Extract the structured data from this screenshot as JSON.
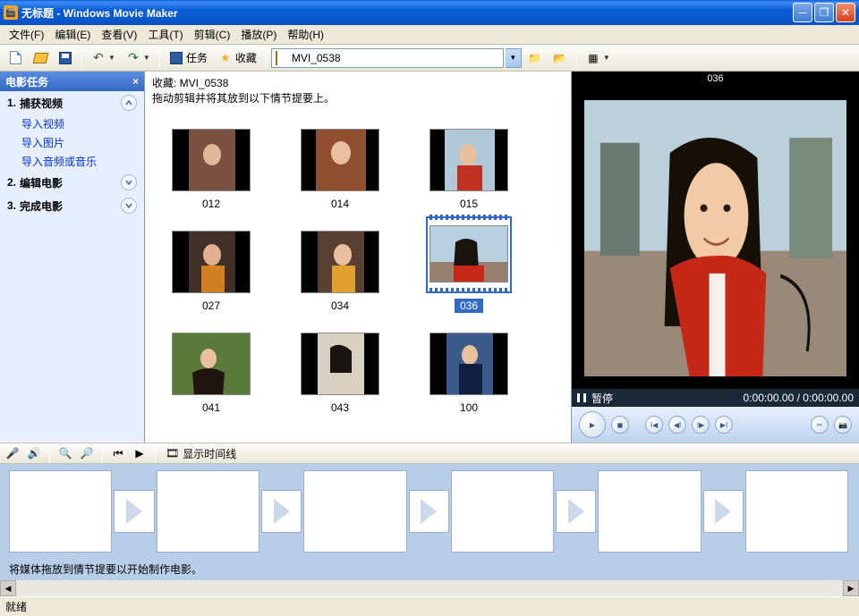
{
  "window": {
    "title": "无标题 - Windows Movie Maker"
  },
  "menu": {
    "file": "文件(F)",
    "edit": "编辑(E)",
    "view": "查看(V)",
    "tools": "工具(T)",
    "clip": "剪辑(C)",
    "play": "播放(P)",
    "help": "帮助(H)"
  },
  "toolbar": {
    "tasks": "任务",
    "collection": "收藏",
    "selected_collection": "MVI_0538"
  },
  "tasks": {
    "header": "电影任务",
    "s1": {
      "num": "1.",
      "label": "捕获视频",
      "sub1": "导入视频",
      "sub2": "导入图片",
      "sub3": "导入音频或音乐"
    },
    "s2": {
      "num": "2.",
      "label": "编辑电影"
    },
    "s3": {
      "num": "3.",
      "label": "完成电影"
    }
  },
  "collection": {
    "header_prefix": "收藏: ",
    "name": "MVI_0538",
    "hint": "拖动剪辑并将其放到以下情节提要上。",
    "items": [
      "012",
      "014",
      "015",
      "027",
      "034",
      "036",
      "041",
      "043",
      "100"
    ],
    "selected": "036"
  },
  "preview": {
    "title": "036",
    "status": "暂停",
    "time_cur": "0:00:00.00",
    "time_sep": " / ",
    "time_tot": "0:00:00.00"
  },
  "timeline": {
    "show": "显示时间线"
  },
  "storyboard": {
    "hint": "将媒体拖放到情节提要以开始制作电影。"
  },
  "status": "就绪"
}
